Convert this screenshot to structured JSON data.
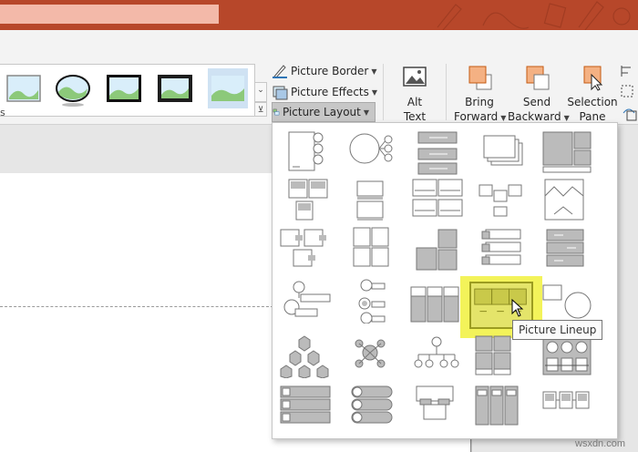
{
  "ribbon": {
    "picture_border": "Picture Border",
    "picture_effects": "Picture Effects",
    "picture_layout": "Picture Layout",
    "alt_text": [
      "Alt",
      "Text"
    ],
    "bring_forward": [
      "Bring",
      "Forward"
    ],
    "send_backward": [
      "Send",
      "Backward"
    ],
    "selection_pane": [
      "Selection",
      "Pane"
    ],
    "group_label_fragment": "s"
  },
  "dropdown": {
    "tooltip": "Picture Lineup",
    "highlighted_item": "Picture Lineup"
  },
  "watermark": "wsxdn.com",
  "colors": {
    "title_bar": "#b7472a",
    "ribbon": "#f3f3f3",
    "highlight": "#f3f35a",
    "accent_orange": "#f4b183",
    "layout_gray": "#b3b3b3"
  },
  "icons": [
    "picture-border-icon",
    "picture-effects-icon",
    "picture-layout-icon",
    "alt-text-icon",
    "bring-forward-icon",
    "send-backward-icon",
    "selection-pane-icon",
    "gallery-scroll-down-icon",
    "gallery-more-icon",
    "mouse-cursor-icon"
  ]
}
